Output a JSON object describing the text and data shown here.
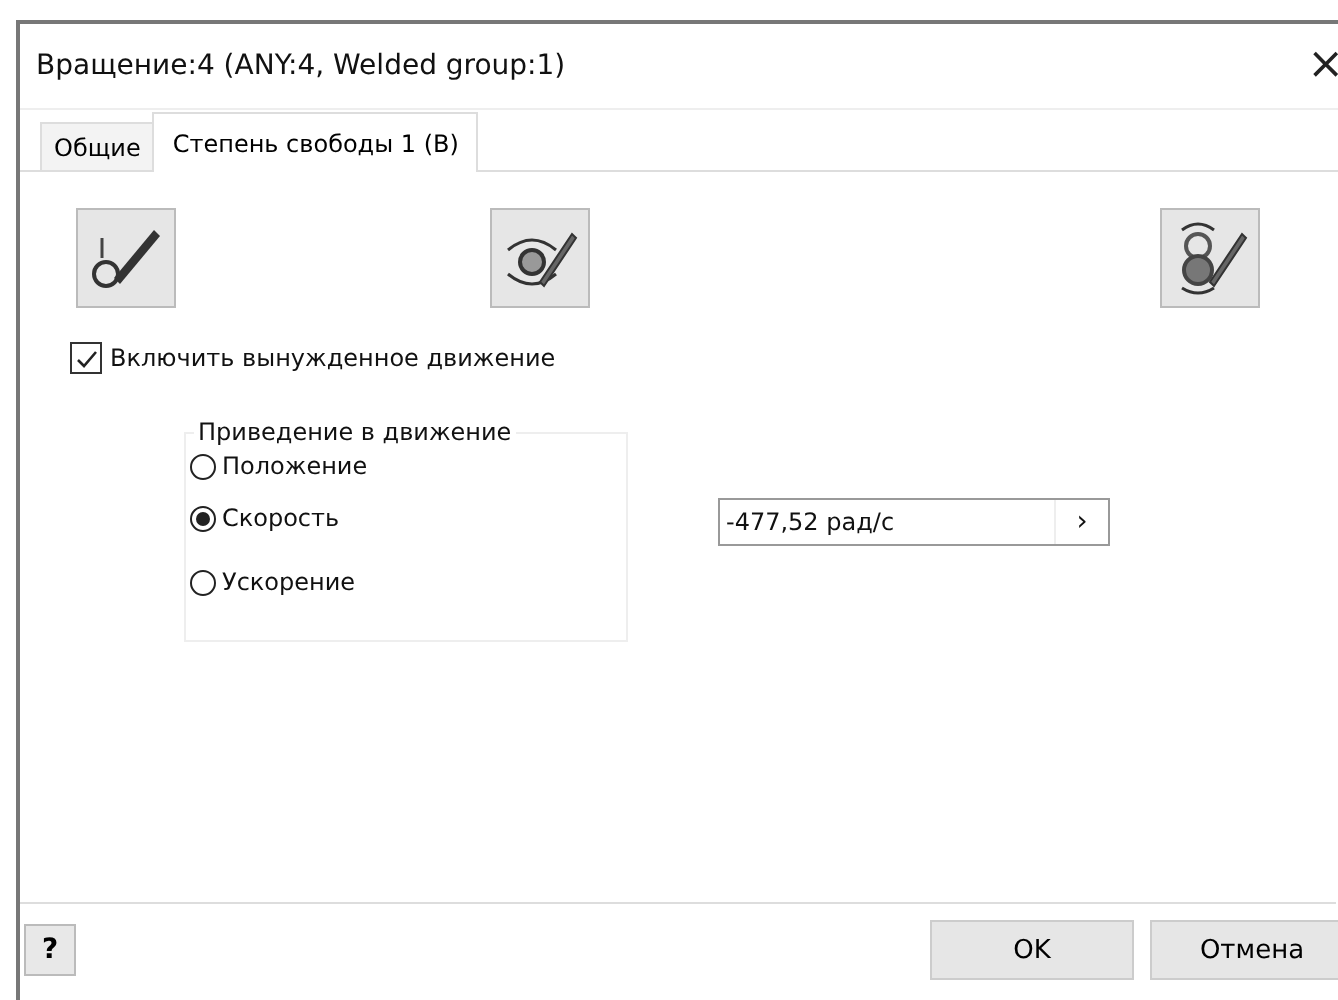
{
  "window": {
    "title": "Вращение:4 (ANY:4, Welded group:1)",
    "close": "×"
  },
  "tabs": [
    {
      "label": "Общие",
      "selected": false
    },
    {
      "label": "Степень свободы 1 (B)",
      "selected": true
    }
  ],
  "tool_buttons": [
    {
      "kind": "linear"
    },
    {
      "kind": "rotate"
    },
    {
      "kind": "double"
    }
  ],
  "enable_motion": {
    "label": "Включить вынужденное движение",
    "checked": true
  },
  "drive_group": {
    "title": "Приведение в движение",
    "options": [
      {
        "label": "Положение",
        "selected": false
      },
      {
        "label": "Скорость",
        "selected": true
      },
      {
        "label": "Ускорение",
        "selected": false
      }
    ]
  },
  "value_field": {
    "value": "-477,52 рад/с",
    "arrow": "›"
  },
  "help_button": "?",
  "buttons": [
    "OK",
    "Отмена"
  ]
}
